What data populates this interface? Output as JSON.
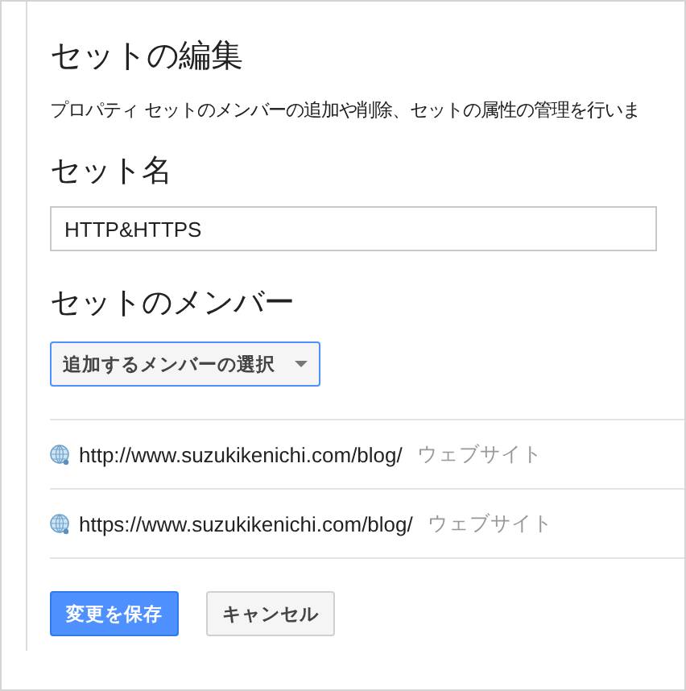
{
  "title": "セットの編集",
  "description": "プロパティ セットのメンバーの追加や削除、セットの属性の管理を行いま",
  "name_section": {
    "heading": "セット名",
    "value": "HTTP&HTTPS"
  },
  "members_section": {
    "heading": "セットのメンバー",
    "dropdown": "追加するメンバーの選択",
    "members": [
      {
        "url": "http://www.suzukikenichi.com/blog/",
        "type": "ウェブサイト"
      },
      {
        "url": "https://www.suzukikenichi.com/blog/",
        "type": "ウェブサイト"
      }
    ]
  },
  "buttons": [
    {
      "label": "変更を保存",
      "kind": "primary"
    },
    {
      "label": "キャンセル",
      "kind": "secondary"
    }
  ]
}
